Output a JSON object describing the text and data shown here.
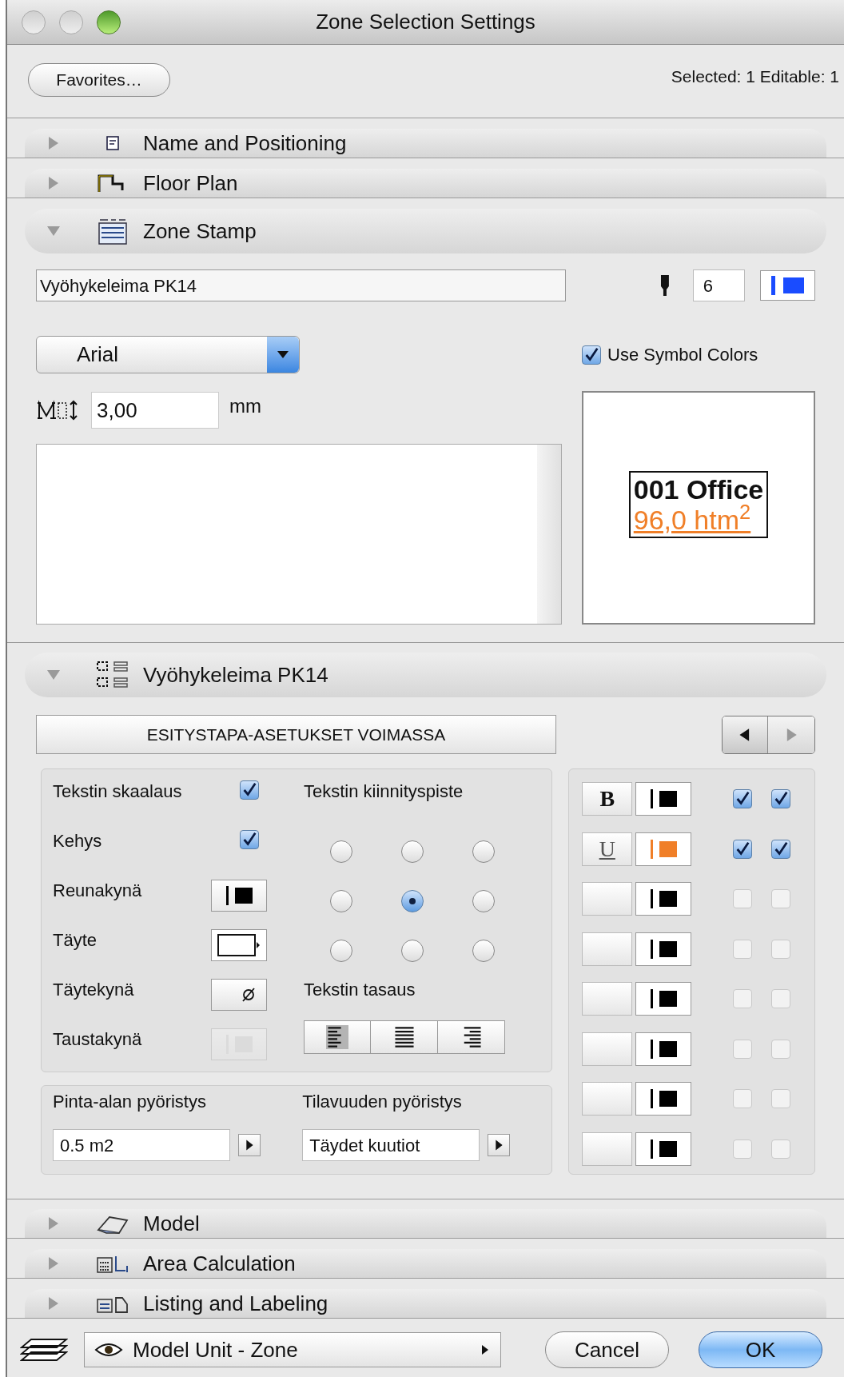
{
  "window": {
    "title": "Zone Selection Settings"
  },
  "favorites_button": "Favorites…",
  "selection_info": "Selected: 1 Editable: 1",
  "sections": [
    {
      "title": "Name and Positioning",
      "expanded": false
    },
    {
      "title": "Floor Plan",
      "expanded": false
    },
    {
      "title": "Zone Stamp",
      "expanded": true,
      "stamp": {
        "stamp_name": "Vyöhykeleima PK14",
        "pen_number": "6",
        "font": "Arial",
        "use_symbol_colors": {
          "label": "Use Symbol Colors",
          "checked": true
        },
        "text_size": "3,00",
        "unit": "mm",
        "preview": {
          "name": "001 Office",
          "area": "96,0 htm$^{2}$"
        }
      }
    },
    {
      "title": "Vyöhykeleima PK14",
      "expanded": true,
      "settings": {
        "mode_label": "ESITYSTAPA-ASETUKSET VOIMASSA",
        "options": [
          {
            "label": "Tekstin skaalaus",
            "kind": "checkbox",
            "checked": true
          },
          {
            "label": "Kehys",
            "kind": "checkbox",
            "checked": true
          },
          {
            "label": "Reunakynä",
            "kind": "pen"
          },
          {
            "label": "Täyte",
            "kind": "fill"
          },
          {
            "label": "Täytekynä",
            "kind": "empty_pen"
          },
          {
            "label": "Taustakynä",
            "kind": "disabled_pen"
          }
        ],
        "anchor": {
          "label": "Tekstin kiinnityspiste",
          "points": [
            {
              "selected": false
            },
            {
              "selected": false
            },
            {
              "selected": false
            },
            {
              "selected": false
            },
            {
              "selected": true
            },
            {
              "selected": false
            },
            {
              "selected": false
            },
            {
              "selected": false
            },
            {
              "selected": false
            }
          ]
        },
        "alignment": {
          "label": "Tekstin tasaus",
          "options": [
            {
              "selected": true
            },
            {
              "selected": false
            },
            {
              "selected": false
            }
          ]
        },
        "rounding": [
          {
            "label": "Pinta-alan pyöristys",
            "value": "0.5 m2"
          },
          {
            "label": "Tilavuuden pyöristys",
            "value": "Täydet kuutiot"
          }
        ],
        "style_rows": [
          {
            "style_label": "B",
            "color": "#000000",
            "checks": [
              true,
              true
            ]
          },
          {
            "style_label": "U",
            "color": "#f07f28",
            "checks": [
              true,
              true
            ]
          },
          {
            "color": "#000000",
            "checks": [
              false,
              false
            ]
          },
          {
            "color": "#000000",
            "checks": [
              false,
              false
            ]
          },
          {
            "color": "#000000",
            "checks": [
              false,
              false
            ]
          },
          {
            "color": "#000000",
            "checks": [
              false,
              false
            ]
          },
          {
            "color": "#000000",
            "checks": [
              false,
              false
            ]
          },
          {
            "color": "#000000",
            "checks": [
              false,
              false
            ]
          }
        ]
      }
    },
    {
      "title": "Model",
      "expanded": false
    },
    {
      "title": "Area Calculation",
      "expanded": false
    },
    {
      "title": "Listing and Labeling",
      "expanded": false
    }
  ],
  "view_menu": "Model Unit - Zone",
  "buttons": [
    {
      "label": "Cancel",
      "default": false
    },
    {
      "label": "OK",
      "default": true
    }
  ]
}
